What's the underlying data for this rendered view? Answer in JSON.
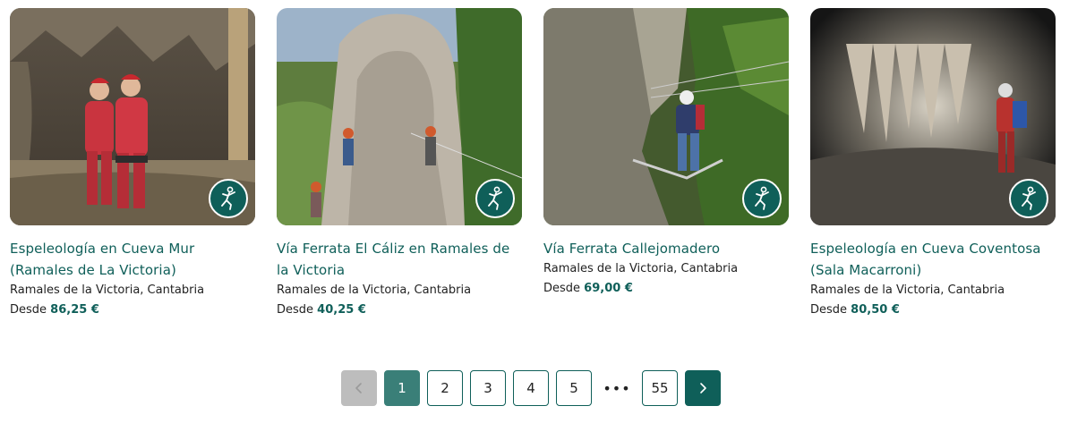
{
  "cards": [
    {
      "title": "Espeleología en Cueva Mur (Ramales de La Victoria)",
      "location": "Ramales de la Victoria, Cantabria",
      "price_prefix": "Desde",
      "price": "86,25 €",
      "image": "cave-explorers-photo"
    },
    {
      "title": "Vía Ferrata El Cáliz en Ramales de la Victoria",
      "location": "Ramales de la Victoria, Cantabria",
      "price_prefix": "Desde",
      "price": "40,25 €",
      "image": "via-ferrata-climbers-photo"
    },
    {
      "title": "Vía Ferrata Callejomadero",
      "location": "Ramales de la Victoria, Cantabria",
      "price_prefix": "Desde",
      "price": "69,00 €",
      "image": "via-ferrata-climber-photo"
    },
    {
      "title": "Espeleología en Cueva Coventosa (Sala Macarroni)",
      "location": "Ramales de la Victoria, Cantabria",
      "price_prefix": "Desde",
      "price": "80,50 €",
      "image": "cave-chamber-photo"
    }
  ],
  "badge_icon": "climber-icon",
  "pagination": {
    "prev_icon": "chevron-left-icon",
    "next_icon": "chevron-right-icon",
    "pages": [
      "1",
      "2",
      "3",
      "4",
      "5"
    ],
    "current": "1",
    "ellipsis": "•••",
    "last": "55"
  },
  "colors": {
    "accent": "#0f5f59",
    "active_page": "#3a7f78",
    "disabled": "#bdbdbd"
  }
}
